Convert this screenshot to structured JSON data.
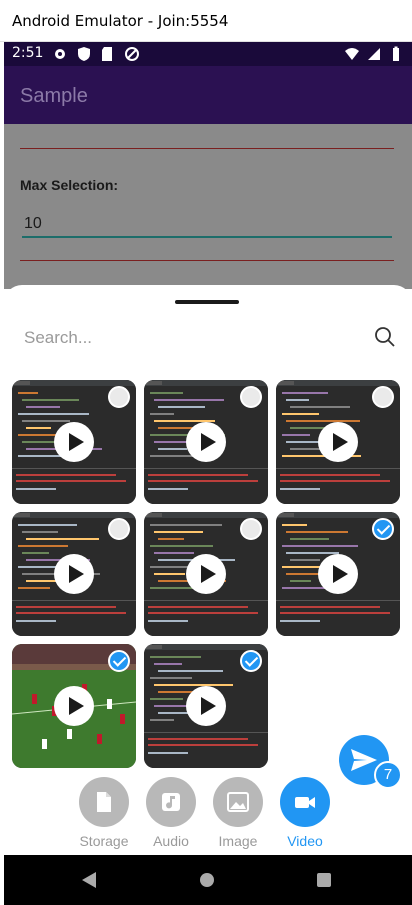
{
  "window": {
    "title": "Android Emulator - Join:5554"
  },
  "status_bar": {
    "time": "2:51",
    "left_icons": [
      "gear-icon",
      "shield-icon",
      "sd-card-icon",
      "no-disturb-icon"
    ],
    "right_icons": [
      "wifi-icon",
      "signal-icon",
      "battery-icon"
    ]
  },
  "app_bar": {
    "title": "Sample"
  },
  "form": {
    "max_selection_label": "Max Selection:",
    "max_selection_value": "10"
  },
  "sheet": {
    "search_placeholder": "Search...",
    "items": [
      {
        "kind": "video",
        "thumbnail": "code-editor",
        "selected": false
      },
      {
        "kind": "video",
        "thumbnail": "code-editor",
        "selected": false
      },
      {
        "kind": "video",
        "thumbnail": "code-editor",
        "selected": false
      },
      {
        "kind": "video",
        "thumbnail": "code-editor",
        "selected": false
      },
      {
        "kind": "video",
        "thumbnail": "code-editor",
        "selected": false
      },
      {
        "kind": "video",
        "thumbnail": "code-editor",
        "selected": true
      },
      {
        "kind": "video",
        "thumbnail": "football-match",
        "selected": true
      },
      {
        "kind": "video",
        "thumbnail": "code-editor",
        "selected": true
      }
    ],
    "send_count": "7",
    "tabs": [
      {
        "label": "Storage",
        "icon": "file-icon",
        "active": false
      },
      {
        "label": "Audio",
        "icon": "music-note-icon",
        "active": false
      },
      {
        "label": "Image",
        "icon": "image-icon",
        "active": false
      },
      {
        "label": "Video",
        "icon": "video-camera-icon",
        "active": true
      }
    ]
  },
  "colors": {
    "accent": "#2196f3",
    "app_bar": "#2b1152",
    "status_bar": "#1a0a3a",
    "inactive_tab": "#b8b8b8",
    "input_underline": "#1d6d6a"
  }
}
